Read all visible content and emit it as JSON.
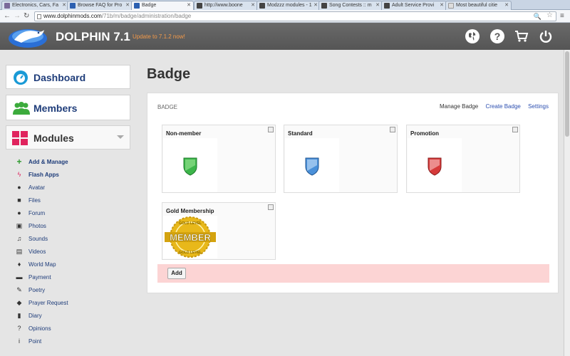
{
  "browser": {
    "tabs": [
      {
        "title": "Electronics, Cars, Fa",
        "active": false,
        "color": "#7a6a9a"
      },
      {
        "title": "Browse FAQ for Pro",
        "active": false,
        "color": "#2b5fb0"
      },
      {
        "title": "Badge",
        "active": true,
        "color": "#2b5fb0"
      },
      {
        "title": "http://www.boone",
        "active": false,
        "color": "#444444"
      },
      {
        "title": "Modzzz modules - 1",
        "active": false,
        "color": "#444444"
      },
      {
        "title": "Song Contests :: m",
        "active": false,
        "color": "#444444"
      },
      {
        "title": "Adult Service Provi",
        "active": false,
        "color": "#444444"
      },
      {
        "title": "Most beautiful citie",
        "active": false,
        "color": "#dddddd"
      }
    ],
    "url_domain": "www.dolphinmods.com",
    "url_path": "/71b/m/badge/administration/badge"
  },
  "header": {
    "title": "DOLPHIN 7.1",
    "update_text": "Update to 7.1.2 now!",
    "icons": [
      "globe-icon",
      "help-icon",
      "cart-icon",
      "power-icon"
    ]
  },
  "sidebar": {
    "dashboard": "Dashboard",
    "members": "Members",
    "modules": "Modules",
    "items": [
      {
        "label": "Add & Manage",
        "icon": "plus-icon",
        "bold": true
      },
      {
        "label": "Flash Apps",
        "icon": "bolt-icon",
        "bold": true
      },
      {
        "label": "Avatar",
        "icon": "user-icon",
        "bold": false
      },
      {
        "label": "Files",
        "icon": "save-icon",
        "bold": false
      },
      {
        "label": "Forum",
        "icon": "comments-icon",
        "bold": false
      },
      {
        "label": "Photos",
        "icon": "picture-icon",
        "bold": false
      },
      {
        "label": "Sounds",
        "icon": "music-icon",
        "bold": false
      },
      {
        "label": "Videos",
        "icon": "film-icon",
        "bold": false
      },
      {
        "label": "World Map",
        "icon": "map-marker-icon",
        "bold": false
      },
      {
        "label": "Payment",
        "icon": "credit-card-icon",
        "bold": false
      },
      {
        "label": "Poetry",
        "icon": "pencil-icon",
        "bold": false
      },
      {
        "label": "Prayer Request",
        "icon": "tags-icon",
        "bold": false
      },
      {
        "label": "Diary",
        "icon": "book-icon",
        "bold": false
      },
      {
        "label": "Opinions",
        "icon": "question-icon",
        "bold": false
      },
      {
        "label": "Point",
        "icon": "info-icon",
        "bold": false
      }
    ]
  },
  "main": {
    "page_title": "Badge",
    "panel_title": "BADGE",
    "links": {
      "manage": "Manage Badge",
      "create": "Create Badge",
      "settings": "Settings"
    },
    "badges": [
      {
        "title": "Non-member",
        "color": "#3cb54a"
      },
      {
        "title": "Standard",
        "color": "#4a90d9"
      },
      {
        "title": "Promotion",
        "color": "#d63a3a"
      },
      {
        "title": "Gold Membership",
        "color": "#e8b81a",
        "seal_text": "MEMBER",
        "ring_text": "GOLD LEVEL"
      }
    ],
    "add_label": "Add"
  }
}
